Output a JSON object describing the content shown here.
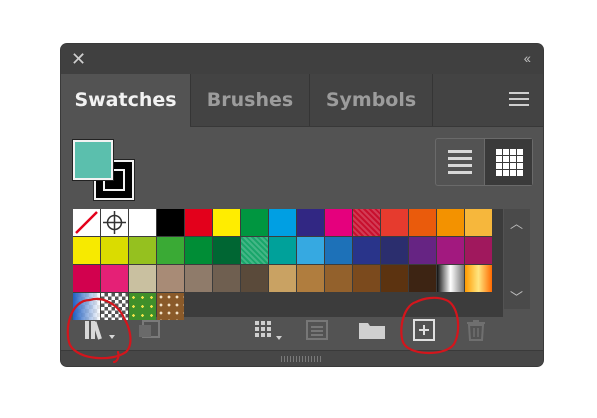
{
  "panel": {
    "close_icon": "close-icon",
    "collapse_glyph": "‹‹",
    "tabs": [
      {
        "label": "Swatches",
        "active": true
      },
      {
        "label": "Brushes",
        "active": false
      },
      {
        "label": "Symbols",
        "active": false
      }
    ],
    "menu_icon": "hamburger-menu-icon"
  },
  "fill_stroke": {
    "fill_color": "#5bbfad",
    "stroke_color": "#000000"
  },
  "view_mode": "grid",
  "swatches": [
    {
      "color": "#ffffff",
      "kind": "none"
    },
    {
      "color": "#ffffff",
      "kind": "registration"
    },
    {
      "color": "#ffffff"
    },
    {
      "color": "#000000"
    },
    {
      "color": "#e3001b"
    },
    {
      "color": "#ffed00"
    },
    {
      "color": "#009640"
    },
    {
      "color": "#009fe3"
    },
    {
      "color": "#312783"
    },
    {
      "color": "#e5007d"
    },
    {
      "color": "#c8102e",
      "kind": "pattern"
    },
    {
      "color": "#e63b2e"
    },
    {
      "color": "#ea5b0c"
    },
    {
      "color": "#f39200"
    },
    {
      "color": "#f6b73c"
    },
    {
      "color": "#f7ea00"
    },
    {
      "color": "#dadc00"
    },
    {
      "color": "#95c11f"
    },
    {
      "color": "#3aaa35"
    },
    {
      "color": "#008d36"
    },
    {
      "color": "#006633"
    },
    {
      "color": "#1aa66b",
      "kind": "pattern"
    },
    {
      "color": "#00a19a"
    },
    {
      "color": "#36a9e1"
    },
    {
      "color": "#1d71b8"
    },
    {
      "color": "#29348a"
    },
    {
      "color": "#2b2e6e"
    },
    {
      "color": "#662483"
    },
    {
      "color": "#a2197f"
    },
    {
      "color": "#a0185d"
    },
    {
      "color": "#d2014e"
    },
    {
      "color": "#e52076"
    },
    {
      "color": "#c9c0a0"
    },
    {
      "color": "#a88b76"
    },
    {
      "color": "#8f7b6a"
    },
    {
      "color": "#6f5f50"
    },
    {
      "color": "#5a4a3a"
    },
    {
      "color": "#c9a263"
    },
    {
      "color": "#b07d3e"
    },
    {
      "color": "#93612c"
    },
    {
      "color": "#7b4a1d"
    },
    {
      "color": "#5c3310"
    },
    {
      "color": "#3d2413"
    },
    {
      "color": "#ffffff",
      "kind": "gradient-bw"
    },
    {
      "color": "#f6c43a",
      "kind": "gradient-orange"
    },
    {
      "color": "#4a88d6",
      "kind": "gradient-checker"
    },
    {
      "color": "#ffffff",
      "kind": "pattern-checker"
    },
    {
      "color": "#3f8f2a",
      "kind": "pattern-green"
    },
    {
      "color": "#8a5a2a",
      "kind": "pattern-brown"
    }
  ],
  "toolbar": {
    "library_icon": "swatch-libraries-icon",
    "place_icon": "place-swatches-icon",
    "kinds_icon": "show-swatch-kinds-icon",
    "options_icon": "swatch-options-icon",
    "folder_icon": "new-color-group-icon",
    "new_icon": "new-swatch-icon",
    "delete_icon": "delete-swatch-icon",
    "annotation_color": "#d4151c"
  }
}
